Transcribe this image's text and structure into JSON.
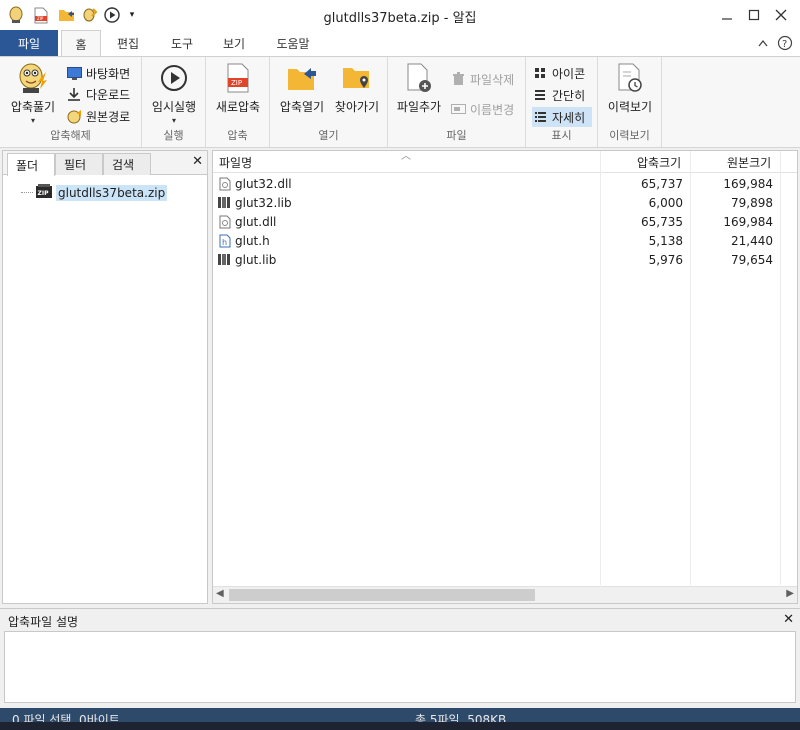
{
  "window": {
    "title": "glutdlls37beta.zip - 알집",
    "controls": [
      "minimize",
      "maximize",
      "close"
    ]
  },
  "quick_access": [
    "alzip-logo-icon",
    "zip-icon",
    "open-folder-icon",
    "wizard-icon",
    "play-icon",
    "dropdown-arrow-icon"
  ],
  "tabs": {
    "file": "파일",
    "items": [
      {
        "label": "홈",
        "active": true
      },
      {
        "label": "편집",
        "active": false
      },
      {
        "label": "도구",
        "active": false
      },
      {
        "label": "보기",
        "active": false
      },
      {
        "label": "도움말",
        "active": false
      }
    ]
  },
  "ribbon": {
    "extract": {
      "group_label": "압축해제",
      "main": "압축풀기",
      "desktop": "바탕화면",
      "download": "다운로드",
      "source_path": "원본경로"
    },
    "run": {
      "group_label": "실행",
      "temp_run": "임시실행"
    },
    "compress": {
      "group_label": "압축",
      "new": "새로압축"
    },
    "open": {
      "group_label": "열기",
      "open_archive": "압축열기",
      "locate": "찾아가기"
    },
    "file": {
      "group_label": "파일",
      "add": "파일추가",
      "delete": "파일삭제",
      "rename": "이름변경"
    },
    "view": {
      "group_label": "표시",
      "icon": "아이콘",
      "simple": "간단히",
      "detail": "자세히",
      "selected": "자세히"
    },
    "history": {
      "group_label": "이력보기",
      "label": "이력보기"
    }
  },
  "left_pane": {
    "tabs": [
      "폴더",
      "필터",
      "검색"
    ],
    "active_tab": "폴더",
    "tree_root": "glutdlls37beta.zip"
  },
  "file_list": {
    "columns": {
      "name": "파일명",
      "packed": "압축크기",
      "original": "원본크기"
    },
    "rows": [
      {
        "name": "glut32.dll",
        "type": "dll",
        "packed": "65,737",
        "original": "169,984"
      },
      {
        "name": "glut32.lib",
        "type": "lib",
        "packed": "6,000",
        "original": "79,898"
      },
      {
        "name": "glut.dll",
        "type": "dll",
        "packed": "65,735",
        "original": "169,984"
      },
      {
        "name": "glut.h",
        "type": "h",
        "packed": "5,138",
        "original": "21,440"
      },
      {
        "name": "glut.lib",
        "type": "lib",
        "packed": "5,976",
        "original": "79,654"
      }
    ]
  },
  "description": {
    "label": "압축파일 설명"
  },
  "status": {
    "left": "0 파일 선택, 0바이트",
    "right": "총 5파일, 508KB"
  },
  "colors": {
    "file_tab": "#2b5797",
    "status_bar": "#2e4a6b",
    "selection": "#cce4f7"
  }
}
